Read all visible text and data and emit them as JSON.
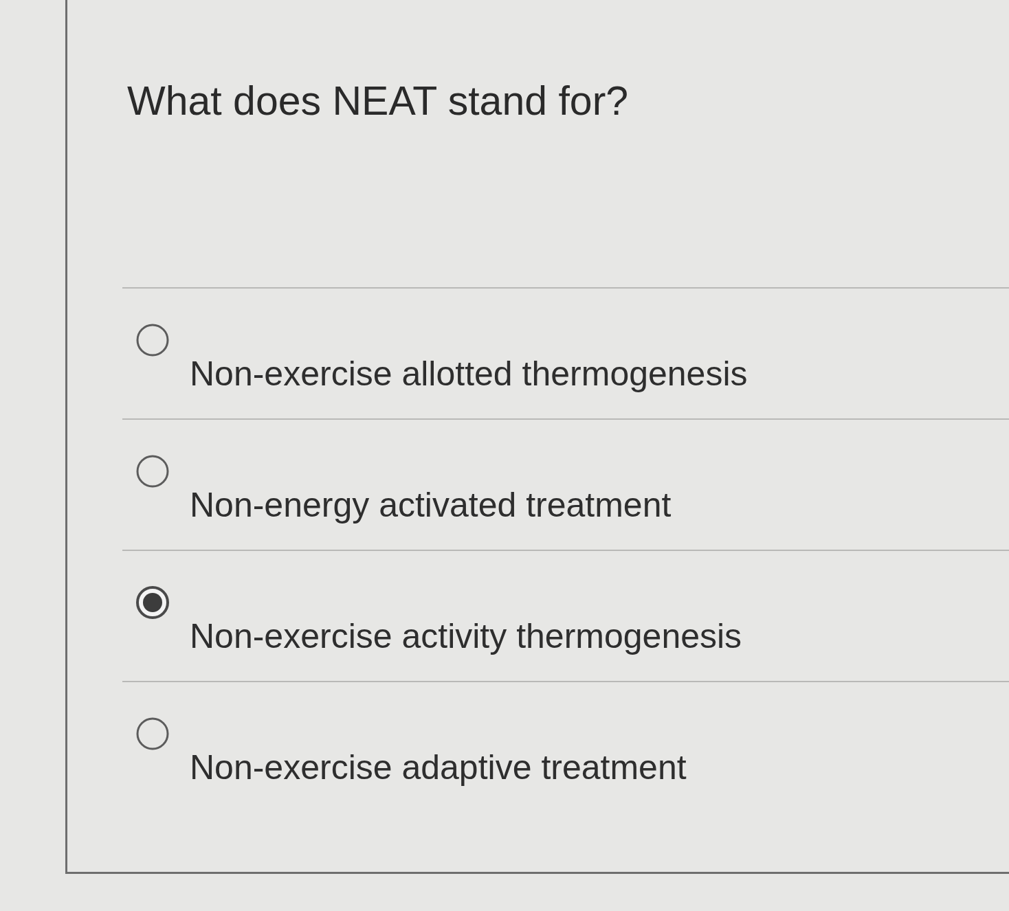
{
  "question": {
    "text": "What does NEAT stand for?"
  },
  "options": [
    {
      "label": "Non-exercise allotted thermogenesis",
      "selected": false
    },
    {
      "label": "Non-energy activated treatment",
      "selected": false
    },
    {
      "label": "Non-exercise activity thermogenesis",
      "selected": true
    },
    {
      "label": "Non-exercise adaptive treatment",
      "selected": false
    }
  ]
}
